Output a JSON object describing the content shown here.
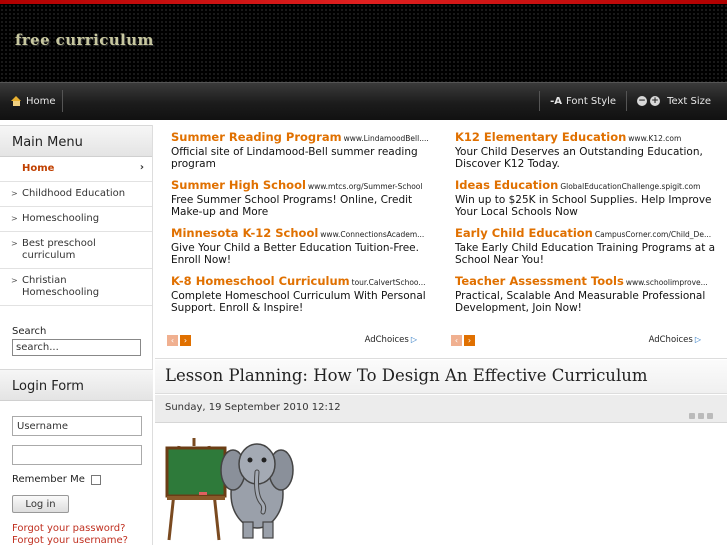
{
  "site": {
    "title": "free curriculum"
  },
  "nav": {
    "home": "Home",
    "font_style": "Font Style",
    "text_size": "Text Size",
    "font_style_glyph": "A",
    "minus_glyph": "−",
    "plus_glyph": "+"
  },
  "main_menu": {
    "title": "Main Menu",
    "items": [
      {
        "label": "Home"
      },
      {
        "label": "Childhood Education"
      },
      {
        "label": "Homeschooling"
      },
      {
        "label": "Best preschool curriculum"
      },
      {
        "label": "Christian Homeschooling"
      }
    ]
  },
  "search": {
    "label": "Search",
    "value": "search..."
  },
  "login": {
    "title": "Login Form",
    "username_value": "Username",
    "password_value": "",
    "remember": "Remember Me",
    "button": "Log in",
    "forgot_password": "Forgot your password?",
    "forgot_username": "Forgot your username?"
  },
  "ads": {
    "left": [
      {
        "title": "Summer Reading Program",
        "url": "www.LindamoodBell....",
        "desc": "Official site of Lindamood-Bell summer reading program"
      },
      {
        "title": "Summer High School",
        "url": "www.mtcs.org/Summer-School",
        "desc": "Free Summer School Programs! Online, Credit Make-up and More"
      },
      {
        "title": "Minnesota K-12 School",
        "url": "www.ConnectionsAcadem...",
        "desc": "Give Your Child a Better Education Tuition-Free. Enroll Now!"
      },
      {
        "title": "K-8 Homeschool Curriculum",
        "url": "tour.CalvertSchoo...",
        "desc": "Complete Homeschool Curriculum With Personal Support. Enroll & Inspire!"
      }
    ],
    "right": [
      {
        "title": "K12 Elementary Education",
        "url": "www.K12.com",
        "desc": "Your Child Deserves an Outstanding Education, Discover K12 Today."
      },
      {
        "title": "Ideas Education",
        "url": "GlobalEducationChallenge.spigit.com",
        "desc": "Win up to $25K in School Supplies. Help Improve Your Local Schools Now"
      },
      {
        "title": "Early Child Education",
        "url": "CampusCorner.com/Child_De...",
        "desc": "Take Early Child Education Training Programs at a School Near You!"
      },
      {
        "title": "Teacher Assessment Tools",
        "url": "www.schoolimprove...",
        "desc": "Practical, Scalable And Measurable Professional Development, Join Now!"
      }
    ],
    "adchoices": "AdChoices",
    "prev_glyph": "‹",
    "next_glyph": "›"
  },
  "article": {
    "title": "Lesson Planning: How To Design An Effective Curriculum",
    "date": "Sunday, 19 September 2010 12:12"
  },
  "colors": {
    "accent": "#e07000",
    "link": "#c03020"
  }
}
